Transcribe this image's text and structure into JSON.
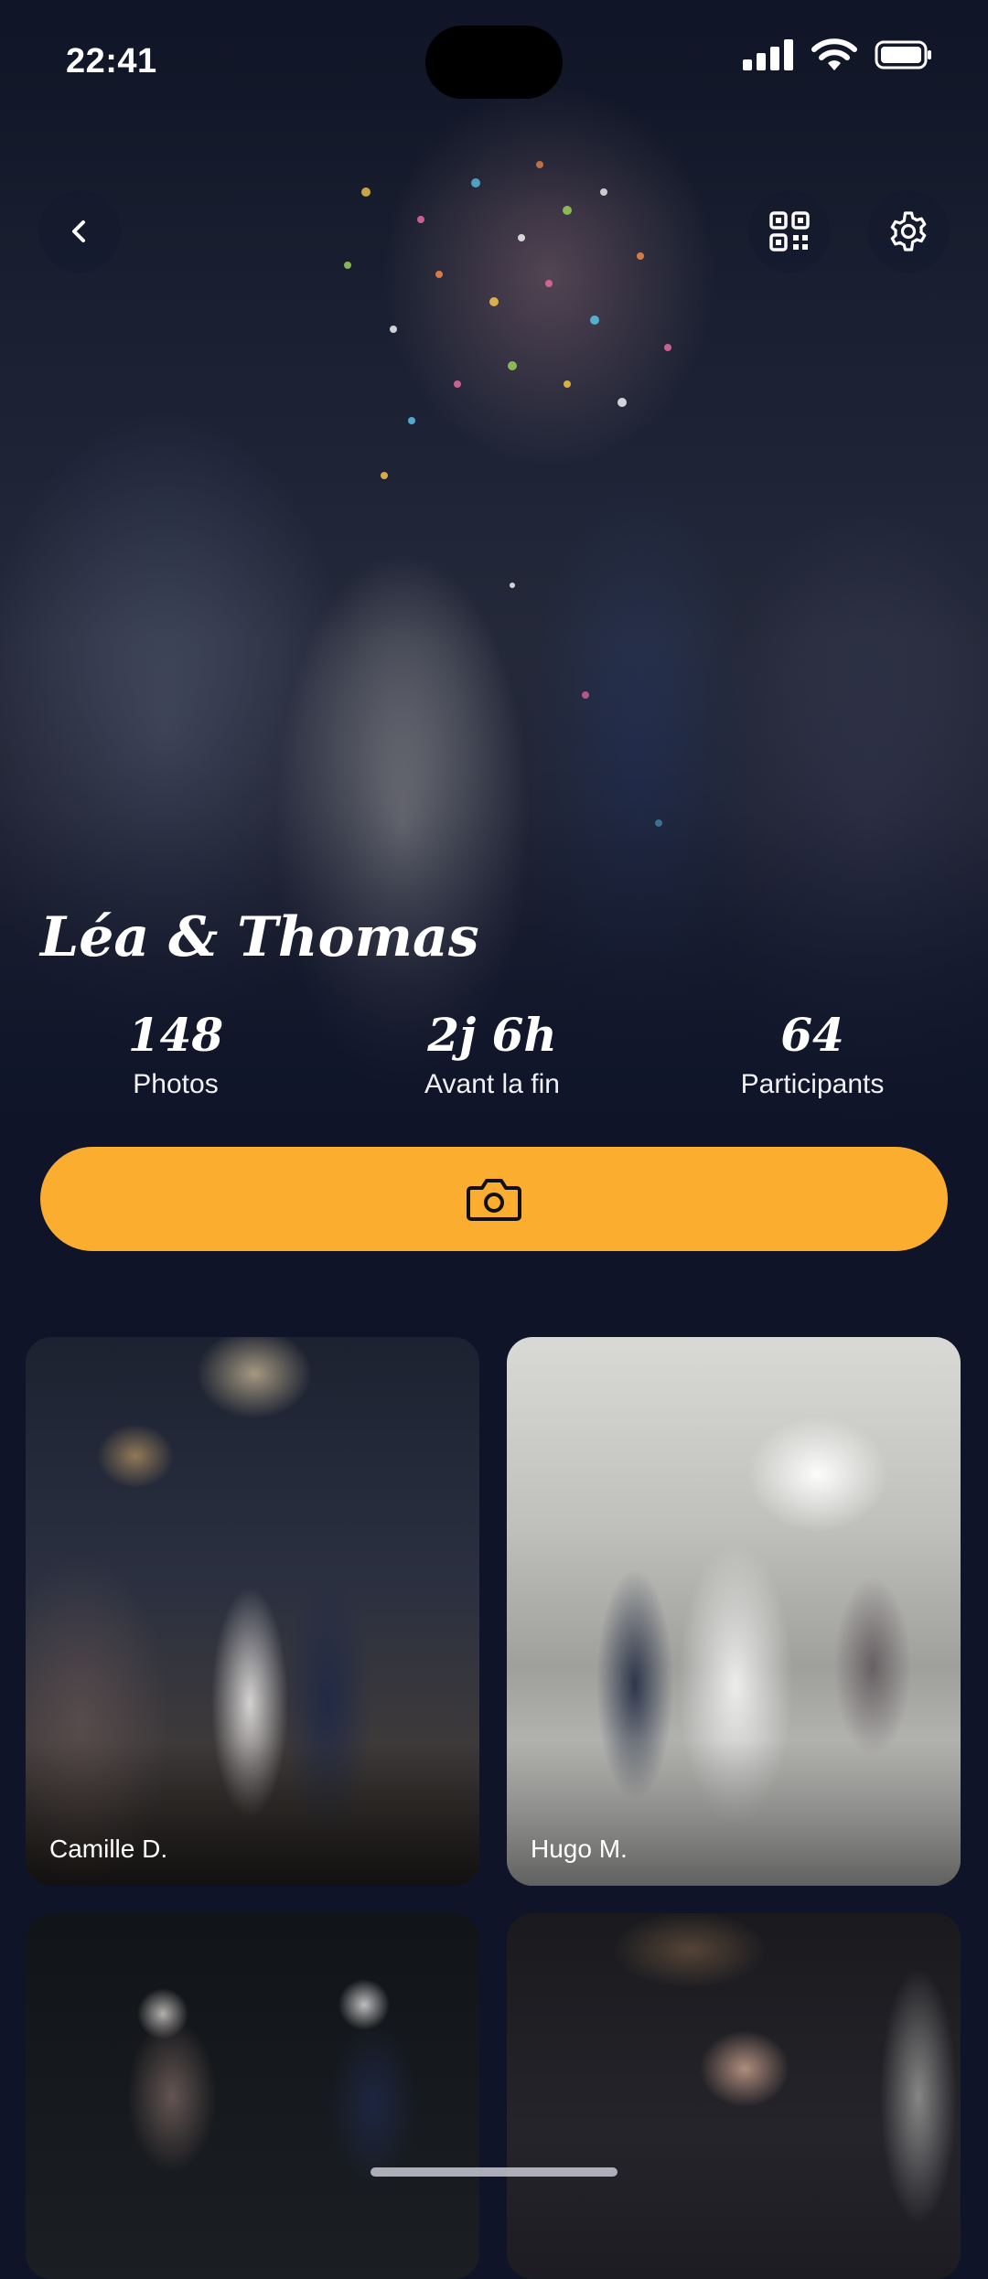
{
  "status_bar": {
    "time": "22:41"
  },
  "event": {
    "couple_name": "Léa & Thomas",
    "stats": [
      {
        "value": "148",
        "label": "Photos"
      },
      {
        "value": "2j 6h",
        "label": "Avant la fin"
      },
      {
        "value": "64",
        "label": "Participants"
      }
    ]
  },
  "icons": {
    "back": "chevron-left-icon",
    "qr": "qr-code-icon",
    "settings": "gear-icon",
    "camera": "camera-icon"
  },
  "colors": {
    "accent": "#fbad30",
    "background": "#0f1428"
  },
  "photos": [
    {
      "author": "Camille D."
    },
    {
      "author": "Hugo M."
    },
    {
      "author": ""
    },
    {
      "author": ""
    }
  ]
}
